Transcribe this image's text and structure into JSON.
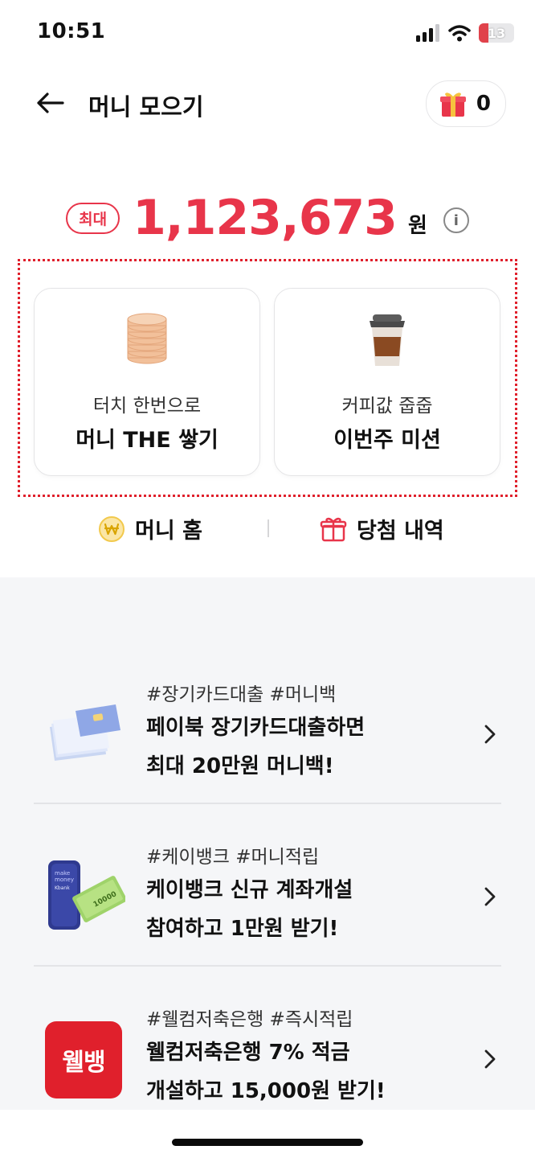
{
  "status": {
    "time": "10:51",
    "battery": "13"
  },
  "header": {
    "title": "머니 모으기",
    "gift_count": "0"
  },
  "summary": {
    "badge": "최대",
    "amount": "1,123,673",
    "unit": "원"
  },
  "cards": [
    {
      "sub": "터치 한번으로",
      "main": "머니 THE 쌓기"
    },
    {
      "sub": "커피값 줍줍",
      "main": "이번주 미션"
    }
  ],
  "links": {
    "money_home": "머니 홈",
    "win_history": "당첨 내역"
  },
  "promos": [
    {
      "tags": "#장기카드대출 #머니백",
      "line1": "페이북 장기카드대출하면",
      "line2": "최대 20만원 머니백!"
    },
    {
      "tags": "#케이뱅크 #머니적립",
      "line1": "케이뱅크 신규 계좌개설",
      "line2": "참여하고 1만원 받기!",
      "phone_text1": "make",
      "phone_text2": "money",
      "phone_text3": "Kbank",
      "bill_text": "10000"
    },
    {
      "tags": "#웰컴저축은행 #즉시적립",
      "line1": "웰컴저축은행 7% 적금",
      "line2": "개설하고 15,000원 받기!",
      "logo_text": "웰뱅"
    }
  ],
  "colors": {
    "accent": "#e8354a",
    "coin": "#f0b98a",
    "dotted": "#e0202c"
  }
}
